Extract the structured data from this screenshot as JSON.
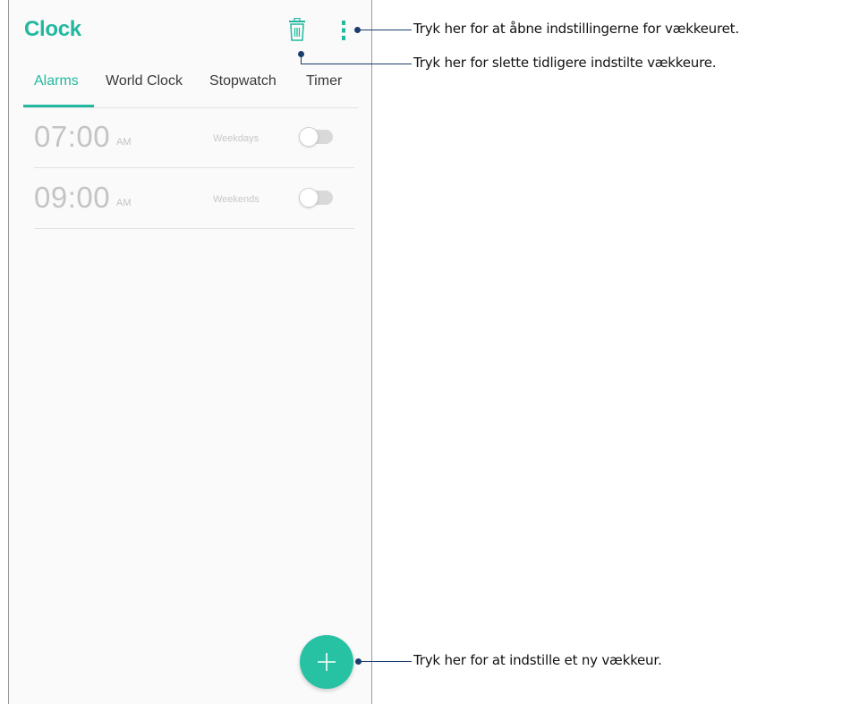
{
  "app": {
    "title": "Clock"
  },
  "toolbar": {
    "delete_icon": "trash-icon",
    "menu_icon": "overflow-menu-icon"
  },
  "tabs": [
    {
      "label": "Alarms",
      "active": true
    },
    {
      "label": "World Clock",
      "active": false
    },
    {
      "label": "Stopwatch",
      "active": false
    },
    {
      "label": "Timer",
      "active": false
    }
  ],
  "alarms": [
    {
      "time": "07:00",
      "ampm": "AM",
      "repeat": "Weekdays",
      "enabled": false
    },
    {
      "time": "09:00",
      "ampm": "AM",
      "repeat": "Weekends",
      "enabled": false
    }
  ],
  "fab": {
    "icon": "plus-icon"
  },
  "callouts": {
    "settings": "Tryk her for at åbne indstillingerne for vækkeuret.",
    "delete": "Tryk her for slette tidligere indstilte vækkeure.",
    "add": "Tryk her for at indstille et ny vækkeur."
  },
  "colors": {
    "accent": "#22b8a0",
    "fab": "#27c2a3",
    "callout_line": "#1b3d6e",
    "inactive_text": "#c4c4c4"
  }
}
